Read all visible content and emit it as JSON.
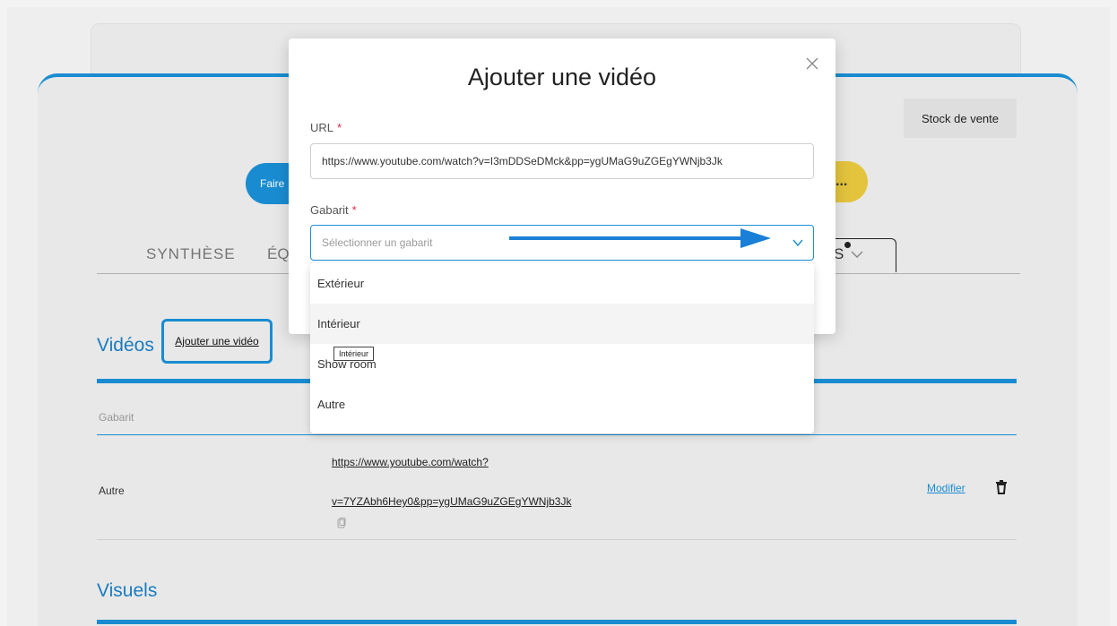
{
  "page": {
    "stock_button": "Stock de vente",
    "action_faire": "Faire",
    "action_more": "...",
    "tabs": [
      {
        "label": "SYNTHÈSE"
      },
      {
        "label": "ÉQ"
      },
      {
        "label": "S"
      }
    ],
    "videos_section": {
      "title": "Vidéos",
      "add_link": "Ajouter une vidéo",
      "column_gabarit": "Gabarit",
      "rows": [
        {
          "gabarit": "Autre",
          "url_line1": "https://www.youtube.com/watch?",
          "url_line2": "v=7YZAbh6Hey0&pp=ygUMaG9uZGEgYWNjb3Jk",
          "edit_label": "Modifier"
        }
      ]
    },
    "visuels_section": {
      "title": "Visuels"
    }
  },
  "modal": {
    "title": "Ajouter une vidéo",
    "url_label": "URL",
    "url_required": "*",
    "url_value": "https://www.youtube.com/watch?v=I3mDDSeDMck&pp=ygUMaG9uZGEgYWNjb3Jk",
    "gabarit_label": "Gabarit",
    "gabarit_required": "*",
    "gabarit_placeholder": "Sélectionner un gabarit",
    "options": [
      "Extérieur",
      "Intérieur",
      "Show room",
      "Autre"
    ],
    "tooltip": "Intérieur"
  },
  "colors": {
    "accent": "#1a8fd6",
    "required": "#e0284b",
    "warning": "#e9c83f"
  }
}
